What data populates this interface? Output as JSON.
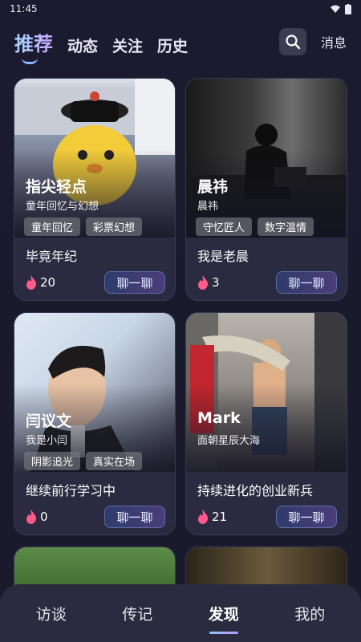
{
  "status": {
    "time": "11:45"
  },
  "top_tabs": [
    "推荐",
    "动态",
    "关注",
    "历史"
  ],
  "messages_label": "消息",
  "cards": [
    {
      "name": "指尖轻点",
      "subtitle": "童年回忆与幻想",
      "tags": [
        "童年回忆",
        "彩票幻想"
      ],
      "title": "毕竟年纪",
      "count": "20",
      "chat": "聊一聊"
    },
    {
      "name": "晨祎",
      "subtitle": "晨祎",
      "tags": [
        "守忆匠人",
        "数字温情"
      ],
      "title": "我是老晨",
      "count": "3",
      "chat": "聊一聊"
    },
    {
      "name": "闫议文",
      "subtitle": "我是小闫",
      "tags": [
        "阴影追光",
        "真实在场"
      ],
      "title": "继续前行学习中",
      "count": "0",
      "chat": "聊一聊"
    },
    {
      "name": "Mark",
      "subtitle": "面朝星辰大海",
      "tags": [],
      "title": "持续进化的创业新兵",
      "count": "21",
      "chat": "聊一聊"
    }
  ],
  "bottom_nav": [
    "访谈",
    "传记",
    "发现",
    "我的"
  ],
  "colors": {
    "accent": "#8fc3ff",
    "flame": "#ff5a8a"
  }
}
